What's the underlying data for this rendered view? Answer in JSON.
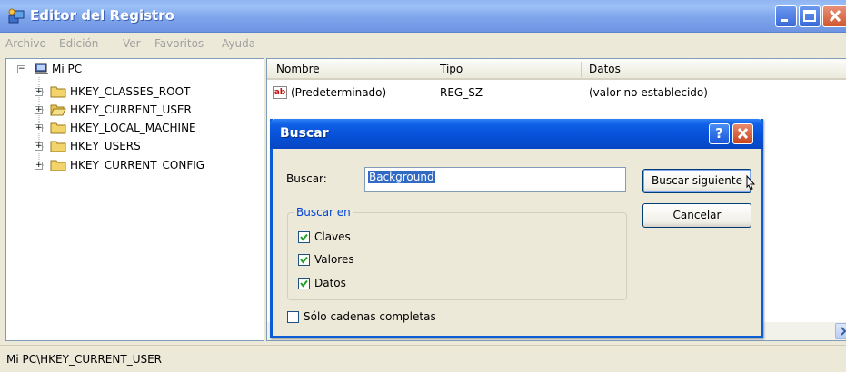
{
  "window": {
    "title": "Editor del Registro",
    "menu": [
      "Archivo",
      "Edición",
      "Ver",
      "Favoritos",
      "Ayuda"
    ]
  },
  "tree": {
    "root": "Mi PC",
    "items": [
      {
        "label": "HKEY_CLASSES_ROOT"
      },
      {
        "label": "HKEY_CURRENT_USER"
      },
      {
        "label": "HKEY_LOCAL_MACHINE"
      },
      {
        "label": "HKEY_USERS"
      },
      {
        "label": "HKEY_CURRENT_CONFIG"
      }
    ]
  },
  "list": {
    "columns": [
      "Nombre",
      "Tipo",
      "Datos"
    ],
    "rows": [
      {
        "icon": "ab",
        "name": "(Predeterminado)",
        "type": "REG_SZ",
        "data": "(valor no establecido)"
      }
    ]
  },
  "status": {
    "path": "Mi PC\\HKEY_CURRENT_USER"
  },
  "dialog": {
    "title": "Buscar",
    "help_glyph": "?",
    "find_label": "Buscar:",
    "find_value": "Background",
    "find_next_label": "Buscar siguiente",
    "cancel_label": "Cancelar",
    "look_in_label": "Buscar en",
    "options": [
      {
        "label": "Claves",
        "checked": true
      },
      {
        "label": "Valores",
        "checked": true
      },
      {
        "label": "Datos",
        "checked": true
      }
    ],
    "whole_string": {
      "label": "Sólo cadenas completas",
      "checked": false
    }
  },
  "colors": {
    "titlebar": "#7ea4ec",
    "dialog_titlebar": "#0650d6",
    "selection": "#316ac5",
    "group_legend": "#0046d5"
  }
}
